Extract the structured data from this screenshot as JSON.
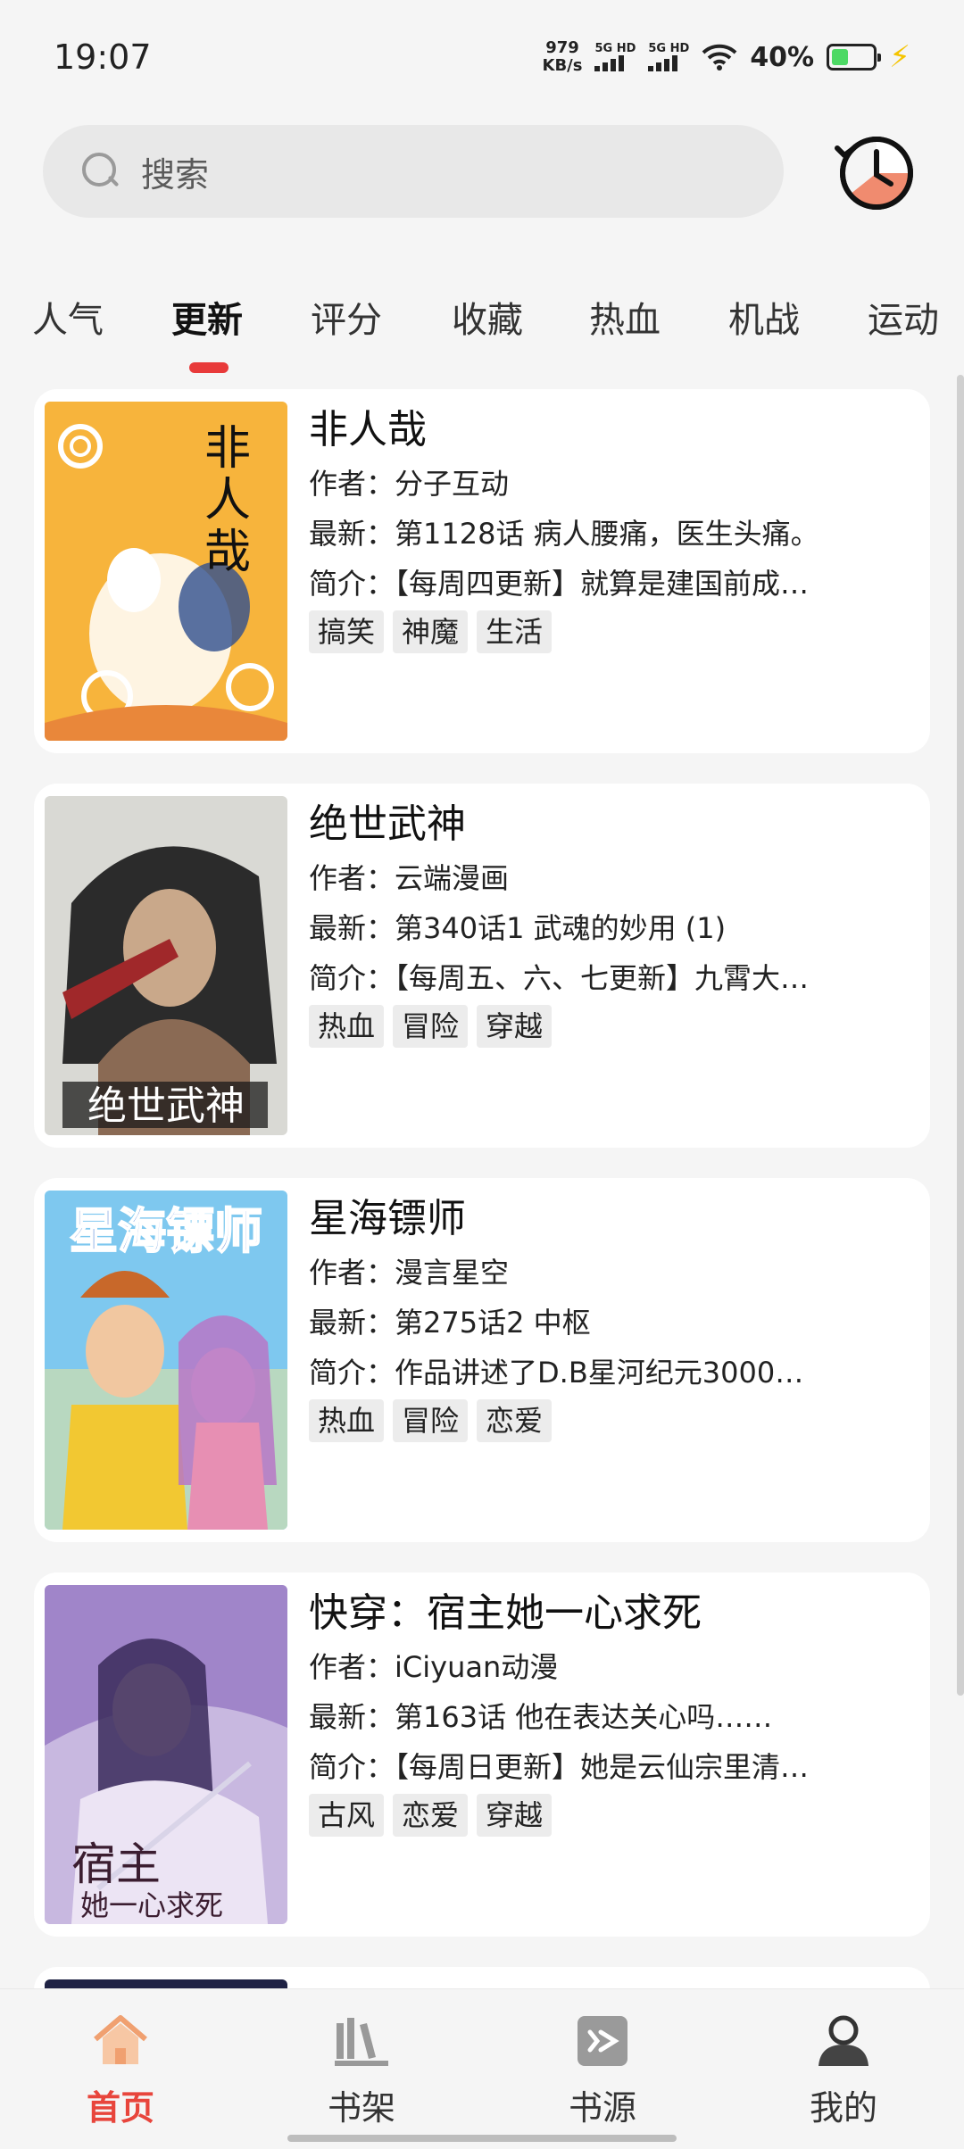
{
  "status_bar": {
    "time": "19:07",
    "net_speed_value": "979",
    "net_speed_unit": "KB/s",
    "sim1": "5G HD",
    "sim2": "5G HD",
    "battery": "40%",
    "battery_level": 0.4
  },
  "search": {
    "placeholder": "搜索"
  },
  "tabs": [
    "人气",
    "更新",
    "评分",
    "收藏",
    "热血",
    "机战",
    "运动"
  ],
  "active_tab": "更新",
  "comics": [
    {
      "title": "非人哉",
      "author": "作者：分子互动",
      "latest": "最新：第1128话 病人腰痛，医生头痛。",
      "intro": "简介：【每周四更新】就算是建国前成…",
      "tags": [
        "搞笑",
        "神魔",
        "生活"
      ],
      "cover_text": "非人哉"
    },
    {
      "title": "绝世武神",
      "author": "作者：云端漫画",
      "latest": "最新：第340话1 武魂的妙用 (1)",
      "intro": "简介：【每周五、六、七更新】九霄大…",
      "tags": [
        "热血",
        "冒险",
        "穿越"
      ],
      "cover_text": "绝世武神"
    },
    {
      "title": "星海镖师",
      "author": "作者：漫言星空",
      "latest": "最新：第275话2 中枢",
      "intro": "简介：作品讲述了D.B星河纪元3000…",
      "tags": [
        "热血",
        "冒险",
        "恋爱"
      ],
      "cover_text": "星海镖师"
    },
    {
      "title": "快穿：宿主她一心求死",
      "author": "作者：iCiyuan动漫",
      "latest": "最新：第163话 他在表达关心吗……",
      "intro": "简介：【每周日更新】她是云仙宗里清…",
      "tags": [
        "古风",
        "恋爱",
        "穿越"
      ],
      "cover_text": "宿主她一心求死"
    }
  ],
  "bottom_nav": [
    {
      "label": "首页",
      "icon": "home-icon",
      "active": true
    },
    {
      "label": "书架",
      "icon": "bookshelf-icon",
      "active": false
    },
    {
      "label": "书源",
      "icon": "source-icon",
      "active": false
    },
    {
      "label": "我的",
      "icon": "profile-icon",
      "active": false
    }
  ],
  "colors": {
    "accent": "#e8453c",
    "tab_indicator": "#e83a3a",
    "background": "#f5f5f5"
  }
}
